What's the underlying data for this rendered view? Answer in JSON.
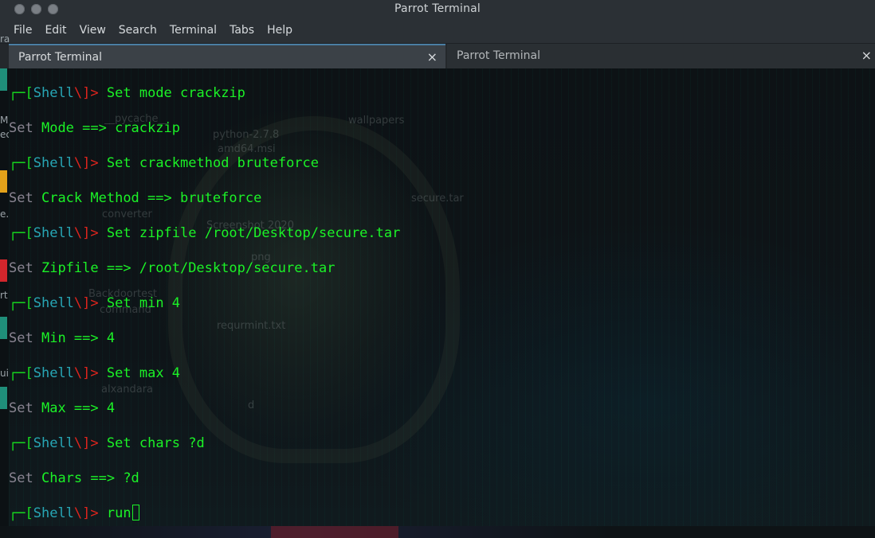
{
  "window": {
    "title": "Parrot Terminal"
  },
  "menu": [
    "File",
    "Edit",
    "View",
    "Search",
    "Terminal",
    "Tabs",
    "Help"
  ],
  "tabs": [
    {
      "label": "Parrot Terminal",
      "close": "×",
      "active": true
    },
    {
      "label": "Parrot Terminal",
      "close": "×",
      "active": false
    }
  ],
  "prompt": {
    "corner": "┌─",
    "open": "[",
    "shell": "Shell",
    "slash": "\\",
    "close": "]>"
  },
  "commands": [
    "Set mode crackzip",
    "Set crackmethod bruteforce",
    "Set zipfile /root/Desktop/secure.tar",
    "Set min 4",
    "Set max 4",
    "Set chars ?d",
    "run"
  ],
  "outputs": [
    {
      "set": "Set",
      "text": "Mode ==> crackzip"
    },
    {
      "set": "Set",
      "text": "Crack Method ==> bruteforce"
    },
    {
      "set": "Set",
      "text": "Zipfile ==> /root/Desktop/secure.tar"
    },
    {
      "set": "Set",
      "text": "Min ==> 4"
    },
    {
      "set": "Set",
      "text": "Max ==> 4"
    },
    {
      "set": "Set",
      "text": "Chars ==> ?d"
    }
  ],
  "desktop_labels": [
    "__pycache__",
    "python-2.7.8",
    "amd64.msi",
    "wallpapers",
    "secure.tar",
    "converter",
    "Screenshot 2020",
    "png",
    "Backdoortest",
    "command",
    "requrmint.txt",
    "alxandara",
    "d"
  ],
  "desktop_strip_fragments": [
    "ra",
    "Ma",
    "ec",
    "e.py",
    "rt",
    "ui"
  ],
  "colors": {
    "prompt_green": "#17e21f",
    "shell_teal": "#27a6b5",
    "slash_red": "#e0241d",
    "text_green": "#1bf227",
    "set_gray": "#8a8592",
    "tab_accent": "#4a7ea3"
  }
}
